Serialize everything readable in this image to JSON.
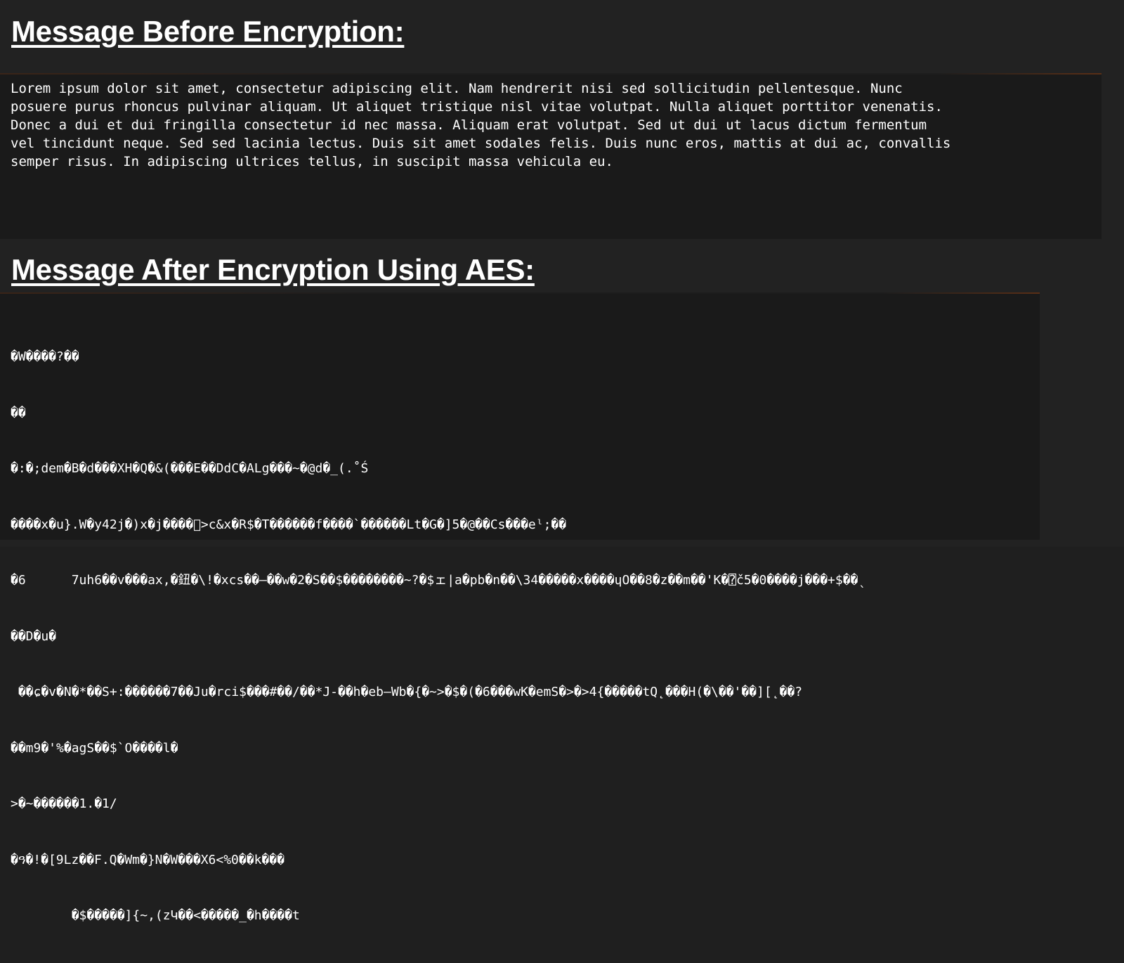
{
  "before": {
    "heading": "Message Before Encryption:",
    "lines": [
      "Lorem ipsum dolor sit amet, consectetur adipiscing elit. Nam hendrerit nisi sed sollicitudin pellentesque. Nunc",
      "posuere purus rhoncus pulvinar aliquam. Ut aliquet tristique nisl vitae volutpat. Nulla aliquet porttitor venenatis.",
      "Donec a dui et dui fringilla consectetur id nec massa. Aliquam erat volutpat. Sed ut dui ut lacus dictum fermentum",
      "vel tincidunt neque. Sed sed lacinia lectus. Duis sit amet sodales felis. Duis nunc eros, mattis at dui ac, convallis",
      "semper risus. In adipiscing ultrices tellus, in suscipit massa vehicula eu."
    ]
  },
  "after": {
    "heading": "Message After Encryption Using AES:",
    "lines": [
      "�W����?��",
      "��",
      "�:�;dem�B�d���XH�Q�&(���E��DdC�ALg���~�@d�_(.˚Ś",
      "����x�u}.W�y42j�)x�j����⃞>c&x�R$�T������f����`������Lt�G�]5�@��Cs���eˡ;��",
      "�6      7uh6��v���ax,�鈕�\\!�xcs��—��w�2�S��$��������~?�$ェ|a�pb�n��\\34�����x����ɥO��8�z��m��'K�⍰č5�0����j���+$��ˎ",
      "��D�u�",
      " ��ɕ�v�N�*��S+:������7��Ju�rci$���#��/��*J-��h�eb—Wb�{�~>�$�(�6���wK�emS�>�>4{�����tQ˛���H(�\\��'��][˛��?",
      "��m9�'%�agS��$`O����l�",
      ">�~������1.�1/",
      "�ዓ�!�[9Lz��F.Q�Wm�}N�W���X6<%0��k���",
      "        �$�����]{~,(zԿ��<�����_�h����t"
    ]
  }
}
